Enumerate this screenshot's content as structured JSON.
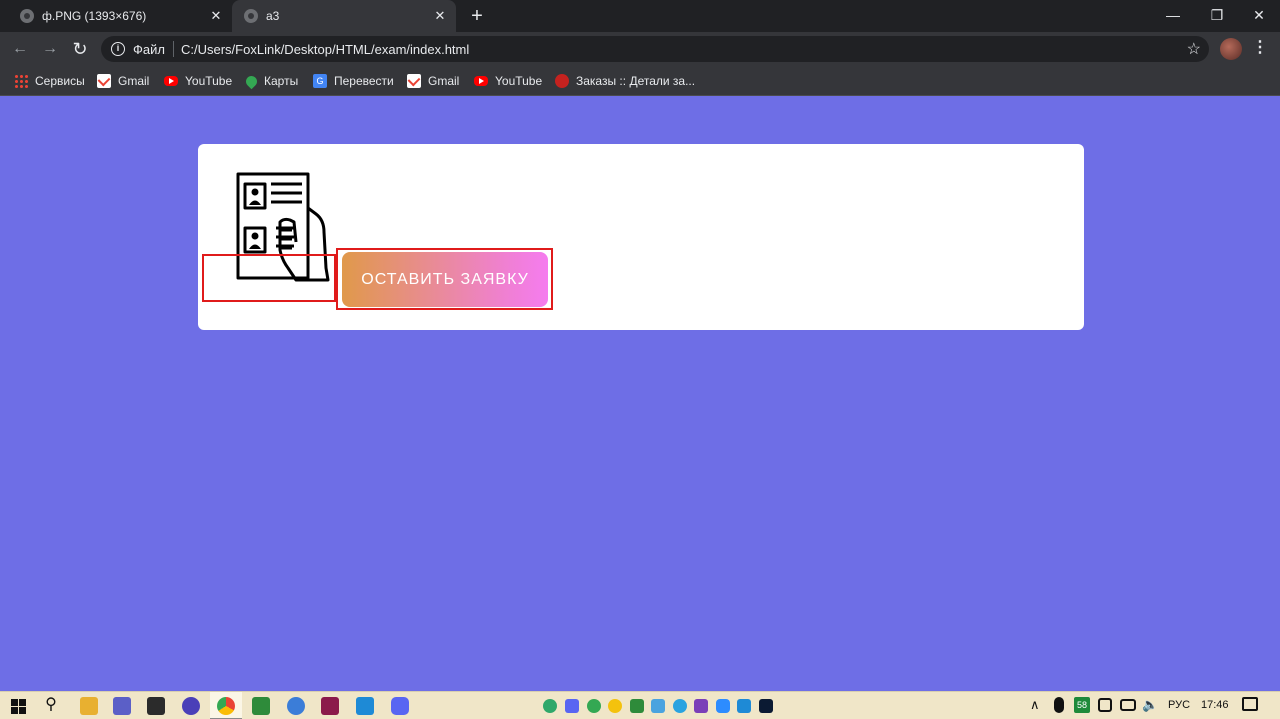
{
  "browser": {
    "tabs": [
      {
        "title": "ф.PNG (1393×676)",
        "active": false,
        "close": "✕"
      },
      {
        "title": "а3",
        "active": true,
        "close": "✕"
      }
    ],
    "new_tab": "+",
    "window_controls": {
      "minimize": "—",
      "restore": "❐",
      "close": "✕"
    },
    "toolbar": {
      "back": "←",
      "forward": "→",
      "reload": "↻",
      "info": "i",
      "star": "☆",
      "menu": "⋮"
    },
    "address": {
      "scheme_label": "Файл",
      "url": "C:/Users/FoxLink/Desktop/HTML/exam/index.html"
    },
    "bookmarks": [
      {
        "label": "Сервисы",
        "icon": "apps-icon"
      },
      {
        "label": "Gmail",
        "icon": "gmail-icon"
      },
      {
        "label": "YouTube",
        "icon": "youtube-icon"
      },
      {
        "label": "Карты",
        "icon": "maps-icon"
      },
      {
        "label": "Перевести",
        "icon": "translate-icon"
      },
      {
        "label": "Gmail",
        "icon": "gmail-icon"
      },
      {
        "label": "YouTube",
        "icon": "youtube-icon"
      },
      {
        "label": "Заказы :: Детали за...",
        "icon": "orders-icon"
      }
    ]
  },
  "page": {
    "background": "#6e6ee6",
    "card": {
      "icon": "document-in-hand-icon",
      "button_label": "ОСТАВИТЬ ЗАЯВКУ",
      "highlight_color": "#e01b1b"
    }
  },
  "taskbar": {
    "search_glyph": "⚲",
    "tray": {
      "chevron": "∧",
      "badge": "58",
      "volume": "🔈",
      "language": "РУС",
      "time": "17:46"
    }
  }
}
